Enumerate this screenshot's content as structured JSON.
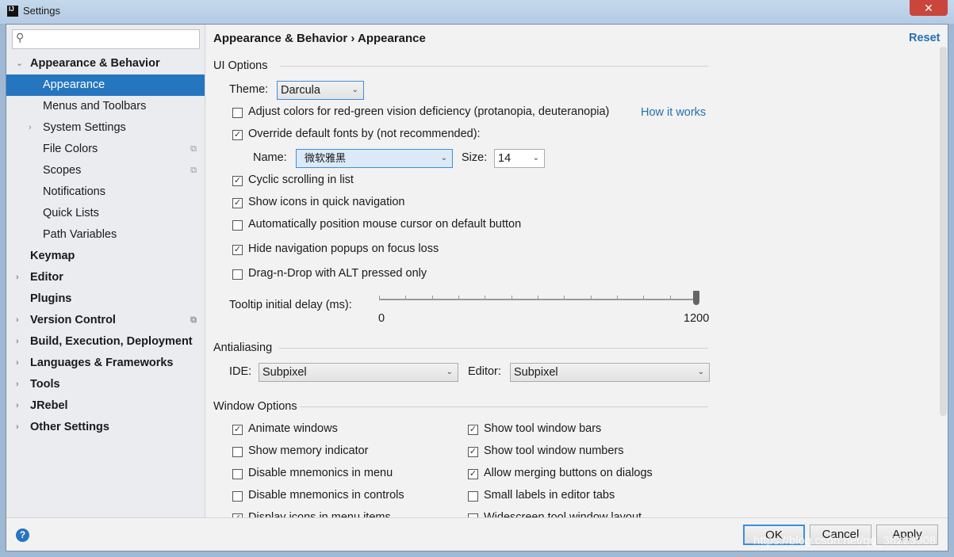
{
  "window": {
    "title": "Settings",
    "close": "✕"
  },
  "sidebar": {
    "search_placeholder": "",
    "items": [
      {
        "label": "Appearance & Behavior",
        "level": 0,
        "bold": true,
        "arrow": "⌄"
      },
      {
        "label": "Appearance",
        "level": 1,
        "selected": true
      },
      {
        "label": "Menus and Toolbars",
        "level": 1
      },
      {
        "label": "System Settings",
        "level": 1,
        "arrow": "›"
      },
      {
        "label": "File Colors",
        "level": 1,
        "project": true
      },
      {
        "label": "Scopes",
        "level": 1,
        "project": true
      },
      {
        "label": "Notifications",
        "level": 1
      },
      {
        "label": "Quick Lists",
        "level": 1
      },
      {
        "label": "Path Variables",
        "level": 1
      },
      {
        "label": "Keymap",
        "level": 0,
        "bold": true
      },
      {
        "label": "Editor",
        "level": 0,
        "bold": true,
        "arrow": "›"
      },
      {
        "label": "Plugins",
        "level": 0,
        "bold": true
      },
      {
        "label": "Version Control",
        "level": 0,
        "bold": true,
        "arrow": "›",
        "project": true
      },
      {
        "label": "Build, Execution, Deployment",
        "level": 0,
        "bold": true,
        "arrow": "›"
      },
      {
        "label": "Languages & Frameworks",
        "level": 0,
        "bold": true,
        "arrow": "›"
      },
      {
        "label": "Tools",
        "level": 0,
        "bold": true,
        "arrow": "›"
      },
      {
        "label": "JRebel",
        "level": 0,
        "bold": true,
        "arrow": "›"
      },
      {
        "label": "Other Settings",
        "level": 0,
        "bold": true,
        "arrow": "›"
      }
    ]
  },
  "header": {
    "breadcrumb": "Appearance & Behavior › Appearance",
    "reset": "Reset"
  },
  "ui_options": {
    "title": "UI Options",
    "theme_label": "Theme:",
    "theme": "Darcula",
    "adjust_colors": "Adjust colors for red-green vision deficiency (protanopia, deuteranopia)",
    "how_it_works": "How it works",
    "override_fonts": "Override default fonts by (not recommended):",
    "name_label": "Name:",
    "font_name": "微软雅黑",
    "size_label": "Size:",
    "font_size": "14",
    "cyclic": "Cyclic scrolling in list",
    "show_icons": "Show icons in quick navigation",
    "auto_mouse": "Automatically position mouse cursor on default button",
    "hide_popups": "Hide navigation popups on focus loss",
    "dnd_alt": "Drag-n-Drop with ALT pressed only",
    "tooltip_label": "Tooltip initial delay (ms):",
    "tooltip_min": "0",
    "tooltip_max": "1200",
    "tooltip_value": 1200
  },
  "checks": {
    "adjust": false,
    "override": true,
    "cyclic": true,
    "icons": true,
    "mouse": false,
    "hide": true,
    "dnd": false
  },
  "antialiasing": {
    "title": "Antialiasing",
    "ide_label": "IDE:",
    "ide": "Subpixel",
    "editor_label": "Editor:",
    "editor": "Subpixel"
  },
  "window_options": {
    "title": "Window Options",
    "items": [
      {
        "label": "Animate windows",
        "checked": true
      },
      {
        "label": "Show tool window bars",
        "checked": true
      },
      {
        "label": "Show memory indicator",
        "checked": false
      },
      {
        "label": "Show tool window numbers",
        "checked": true
      },
      {
        "label": "Disable mnemonics in menu",
        "checked": false
      },
      {
        "label": "Allow merging buttons on dialogs",
        "checked": true
      },
      {
        "label": "Disable mnemonics in controls",
        "checked": false
      },
      {
        "label": "Small labels in editor tabs",
        "checked": false
      },
      {
        "label": "Display icons in menu items",
        "checked": true
      },
      {
        "label": "Widescreen tool window layout",
        "checked": false
      }
    ]
  },
  "footer": {
    "help": "?",
    "ok": "OK",
    "cancel": "Cancel",
    "apply": "Apply",
    "watermark": "https://blog.csdn.net/qq_38223908"
  }
}
